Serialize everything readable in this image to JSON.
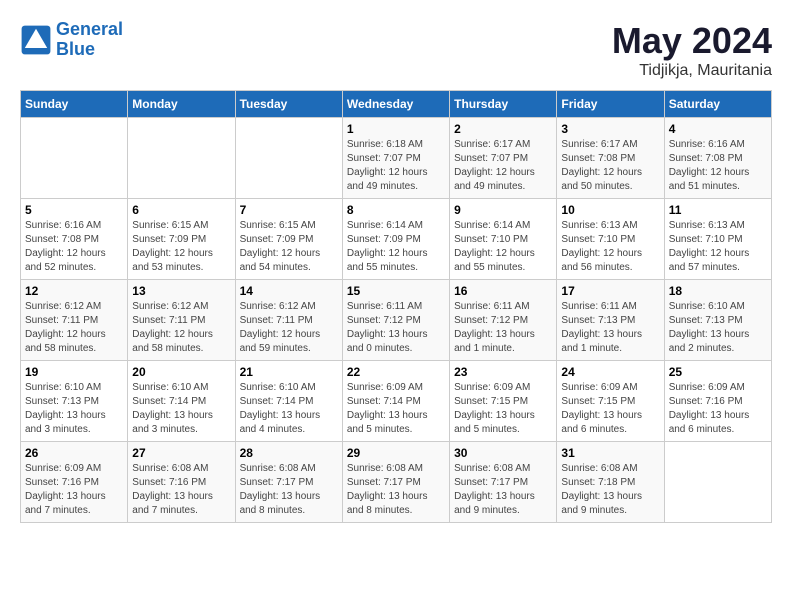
{
  "header": {
    "logo_line1": "General",
    "logo_line2": "Blue",
    "month_year": "May 2024",
    "location": "Tidjikja, Mauritania"
  },
  "weekdays": [
    "Sunday",
    "Monday",
    "Tuesday",
    "Wednesday",
    "Thursday",
    "Friday",
    "Saturday"
  ],
  "weeks": [
    [
      {
        "num": "",
        "detail": ""
      },
      {
        "num": "",
        "detail": ""
      },
      {
        "num": "",
        "detail": ""
      },
      {
        "num": "1",
        "detail": "Sunrise: 6:18 AM\nSunset: 7:07 PM\nDaylight: 12 hours\nand 49 minutes."
      },
      {
        "num": "2",
        "detail": "Sunrise: 6:17 AM\nSunset: 7:07 PM\nDaylight: 12 hours\nand 49 minutes."
      },
      {
        "num": "3",
        "detail": "Sunrise: 6:17 AM\nSunset: 7:08 PM\nDaylight: 12 hours\nand 50 minutes."
      },
      {
        "num": "4",
        "detail": "Sunrise: 6:16 AM\nSunset: 7:08 PM\nDaylight: 12 hours\nand 51 minutes."
      }
    ],
    [
      {
        "num": "5",
        "detail": "Sunrise: 6:16 AM\nSunset: 7:08 PM\nDaylight: 12 hours\nand 52 minutes."
      },
      {
        "num": "6",
        "detail": "Sunrise: 6:15 AM\nSunset: 7:09 PM\nDaylight: 12 hours\nand 53 minutes."
      },
      {
        "num": "7",
        "detail": "Sunrise: 6:15 AM\nSunset: 7:09 PM\nDaylight: 12 hours\nand 54 minutes."
      },
      {
        "num": "8",
        "detail": "Sunrise: 6:14 AM\nSunset: 7:09 PM\nDaylight: 12 hours\nand 55 minutes."
      },
      {
        "num": "9",
        "detail": "Sunrise: 6:14 AM\nSunset: 7:10 PM\nDaylight: 12 hours\nand 55 minutes."
      },
      {
        "num": "10",
        "detail": "Sunrise: 6:13 AM\nSunset: 7:10 PM\nDaylight: 12 hours\nand 56 minutes."
      },
      {
        "num": "11",
        "detail": "Sunrise: 6:13 AM\nSunset: 7:10 PM\nDaylight: 12 hours\nand 57 minutes."
      }
    ],
    [
      {
        "num": "12",
        "detail": "Sunrise: 6:12 AM\nSunset: 7:11 PM\nDaylight: 12 hours\nand 58 minutes."
      },
      {
        "num": "13",
        "detail": "Sunrise: 6:12 AM\nSunset: 7:11 PM\nDaylight: 12 hours\nand 58 minutes."
      },
      {
        "num": "14",
        "detail": "Sunrise: 6:12 AM\nSunset: 7:11 PM\nDaylight: 12 hours\nand 59 minutes."
      },
      {
        "num": "15",
        "detail": "Sunrise: 6:11 AM\nSunset: 7:12 PM\nDaylight: 13 hours\nand 0 minutes."
      },
      {
        "num": "16",
        "detail": "Sunrise: 6:11 AM\nSunset: 7:12 PM\nDaylight: 13 hours\nand 1 minute."
      },
      {
        "num": "17",
        "detail": "Sunrise: 6:11 AM\nSunset: 7:13 PM\nDaylight: 13 hours\nand 1 minute."
      },
      {
        "num": "18",
        "detail": "Sunrise: 6:10 AM\nSunset: 7:13 PM\nDaylight: 13 hours\nand 2 minutes."
      }
    ],
    [
      {
        "num": "19",
        "detail": "Sunrise: 6:10 AM\nSunset: 7:13 PM\nDaylight: 13 hours\nand 3 minutes."
      },
      {
        "num": "20",
        "detail": "Sunrise: 6:10 AM\nSunset: 7:14 PM\nDaylight: 13 hours\nand 3 minutes."
      },
      {
        "num": "21",
        "detail": "Sunrise: 6:10 AM\nSunset: 7:14 PM\nDaylight: 13 hours\nand 4 minutes."
      },
      {
        "num": "22",
        "detail": "Sunrise: 6:09 AM\nSunset: 7:14 PM\nDaylight: 13 hours\nand 5 minutes."
      },
      {
        "num": "23",
        "detail": "Sunrise: 6:09 AM\nSunset: 7:15 PM\nDaylight: 13 hours\nand 5 minutes."
      },
      {
        "num": "24",
        "detail": "Sunrise: 6:09 AM\nSunset: 7:15 PM\nDaylight: 13 hours\nand 6 minutes."
      },
      {
        "num": "25",
        "detail": "Sunrise: 6:09 AM\nSunset: 7:16 PM\nDaylight: 13 hours\nand 6 minutes."
      }
    ],
    [
      {
        "num": "26",
        "detail": "Sunrise: 6:09 AM\nSunset: 7:16 PM\nDaylight: 13 hours\nand 7 minutes."
      },
      {
        "num": "27",
        "detail": "Sunrise: 6:08 AM\nSunset: 7:16 PM\nDaylight: 13 hours\nand 7 minutes."
      },
      {
        "num": "28",
        "detail": "Sunrise: 6:08 AM\nSunset: 7:17 PM\nDaylight: 13 hours\nand 8 minutes."
      },
      {
        "num": "29",
        "detail": "Sunrise: 6:08 AM\nSunset: 7:17 PM\nDaylight: 13 hours\nand 8 minutes."
      },
      {
        "num": "30",
        "detail": "Sunrise: 6:08 AM\nSunset: 7:17 PM\nDaylight: 13 hours\nand 9 minutes."
      },
      {
        "num": "31",
        "detail": "Sunrise: 6:08 AM\nSunset: 7:18 PM\nDaylight: 13 hours\nand 9 minutes."
      },
      {
        "num": "",
        "detail": ""
      }
    ]
  ]
}
